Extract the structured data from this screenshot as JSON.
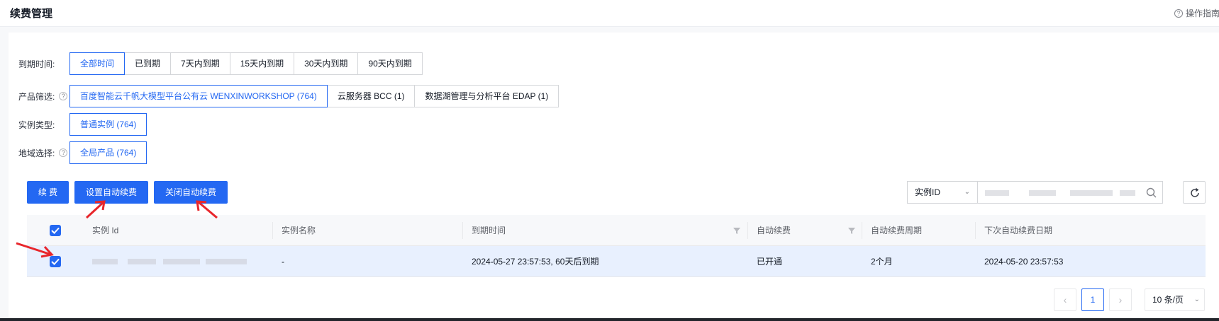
{
  "header": {
    "title": "续费管理",
    "guide_label": "操作指南"
  },
  "filters": {
    "expiry": {
      "label": "到期时间:",
      "options": [
        "全部时间",
        "已到期",
        "7天内到期",
        "15天内到期",
        "30天内到期",
        "90天内到期"
      ],
      "selected": "全部时间"
    },
    "product": {
      "label": "产品筛选:",
      "options": [
        "百度智能云千帆大模型平台公有云 WENXINWORKSHOP (764)",
        "云服务器 BCC (1)",
        "数据湖管理与分析平台 EDAP (1)"
      ],
      "selected": "百度智能云千帆大模型平台公有云 WENXINWORKSHOP (764)"
    },
    "instance_type": {
      "label": "实例类型:",
      "options": [
        "普通实例 (764)"
      ],
      "selected": "普通实例 (764)"
    },
    "region": {
      "label": "地域选择:",
      "options": [
        "全局产品 (764)"
      ],
      "selected": "全局产品 (764)"
    }
  },
  "toolbar": {
    "renew_label": "续 费",
    "set_auto_label": "设置自动续费",
    "close_auto_label": "关闭自动续费",
    "search_field": "实例ID"
  },
  "table": {
    "columns": [
      "实例 Id",
      "实例名称",
      "到期时间",
      "自动续费",
      "自动续费周期",
      "下次自动续费日期"
    ],
    "rows": [
      {
        "checked": true,
        "instance_id": "",
        "name": "-",
        "expire": "2024-05-27 23:57:53, 60天后到期",
        "auto_renew": "已开通",
        "period": "2个月",
        "next_date": "2024-05-20 23:57:53"
      }
    ]
  },
  "pagination": {
    "current_page": "1",
    "page_size": "10 条/页"
  },
  "colors": {
    "accent": "#2468f2",
    "selected_row": "#e8f0fe",
    "annotation": "#e8262b"
  }
}
